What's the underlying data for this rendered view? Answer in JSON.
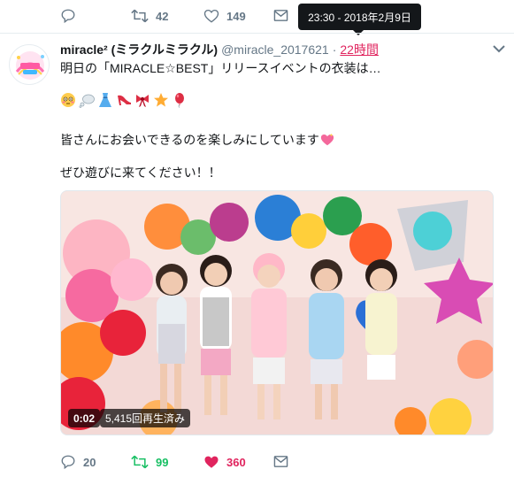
{
  "prev_actions": {
    "reply_count": "",
    "retweet_count": "42",
    "like_count": "149"
  },
  "tooltip": {
    "text": "23:30 - 2018年2月9日"
  },
  "tweet": {
    "display_name": "miracle² (ミラクルミラクル)",
    "handle": "@miracle_2017621",
    "separator": "·",
    "time": "22時間",
    "line1": "明日の「MIRACLE☆BEST」リリースイベントの衣装は…",
    "emojis": [
      "flushed-face",
      "thought-bubble",
      "dress",
      "high-heel",
      "ribbon",
      "star",
      "balloon"
    ],
    "line2": "皆さんにお会いできるのを楽しみにしています",
    "line2_emoji": "heart-with-sparkle",
    "line3": "ぜひ遊びに来てください！！",
    "media": {
      "duration": "0:02",
      "views": "5,415回再生済み"
    },
    "actions": {
      "reply_count": "20",
      "retweet_count": "99",
      "like_count": "360",
      "retweet_color": "#17bf63",
      "like_color": "#e0245e"
    }
  },
  "colors": {
    "text_primary": "#14171a",
    "text_secondary": "#657786",
    "link": "#e0245e",
    "divider": "#e6ecf0"
  }
}
